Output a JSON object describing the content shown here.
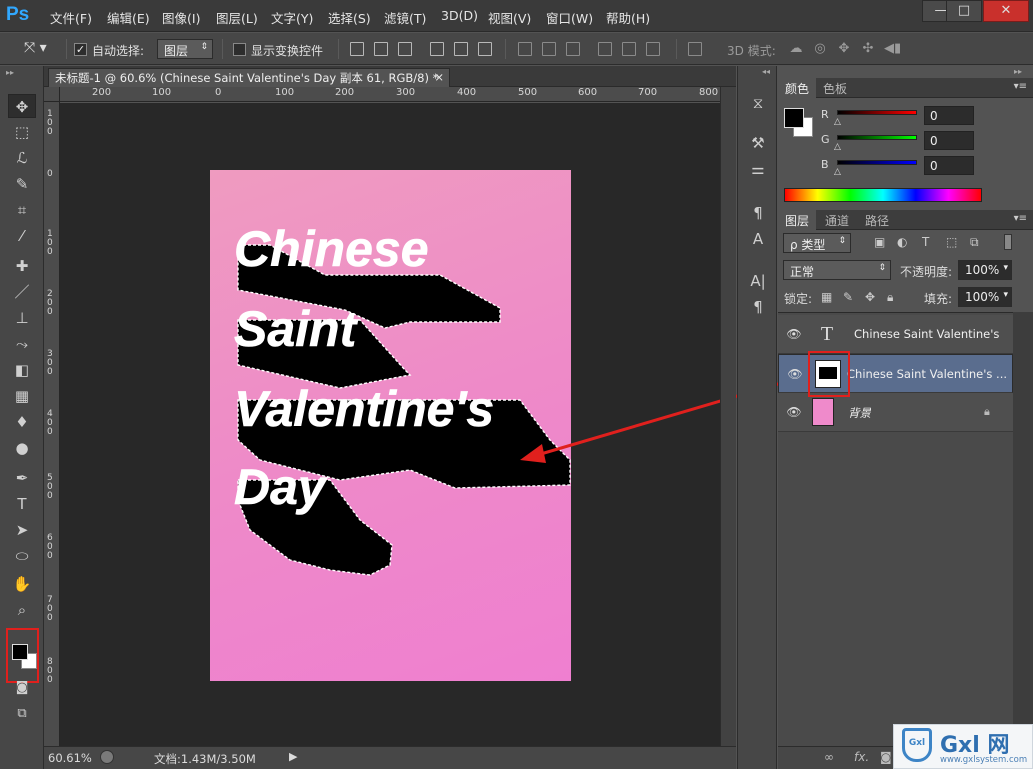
{
  "app": {
    "logo": "Ps"
  },
  "menu": [
    "文件(F)",
    "编辑(E)",
    "图像(I)",
    "图层(L)",
    "文字(Y)",
    "选择(S)",
    "滤镜(T)",
    "3D(D)",
    "视图(V)",
    "窗口(W)",
    "帮助(H)"
  ],
  "window": {
    "min": "—",
    "max": "□",
    "close": "✕"
  },
  "options": {
    "auto_select_label": "自动选择:",
    "auto_select_value": "图层",
    "show_transform_label": "显示变换控件",
    "mode_3d_label": "3D 模式:"
  },
  "document": {
    "tab_title": "未标题-1 @ 60.6% (Chinese  Saint  Valentine's  Day 副本 61, RGB/8) *",
    "tab_close": "×",
    "ruler_top": [
      "200",
      "100",
      "0",
      "100",
      "200",
      "300",
      "400",
      "500",
      "600",
      "700",
      "800"
    ],
    "ruler_left": [
      "1\n0\n0",
      "0",
      "1\n0\n0",
      "2\n0\n0",
      "3\n0\n0",
      "4\n0\n0",
      "5\n0\n0",
      "6\n0\n0",
      "7\n0\n0",
      "8\n0\n0"
    ],
    "canvas_lines": [
      "Chinese",
      "Saint",
      "Valentine's",
      "Day"
    ]
  },
  "status": {
    "zoom": "60.61%",
    "doc_info": "文档:1.43M/3.50M"
  },
  "color_panel": {
    "tabs": [
      "颜色",
      "色板"
    ],
    "channels": [
      {
        "label": "R",
        "value": "0",
        "color": "#d83030"
      },
      {
        "label": "G",
        "value": "0",
        "color": "#30c030"
      },
      {
        "label": "B",
        "value": "0",
        "color": "#3040d8"
      }
    ]
  },
  "layers_panel": {
    "tabs": [
      "图层",
      "通道",
      "路径"
    ],
    "filter_label": "ρ 类型",
    "blend_mode": "正常",
    "opacity_label": "不透明度:",
    "opacity_value": "100%",
    "lock_label": "锁定:",
    "fill_label": "填充:",
    "fill_value": "100%",
    "layers": [
      {
        "name": "Chinese  Saint  Valentine's ...",
        "kind": "text"
      },
      {
        "name": "Chinese  Saint  Valentine's ...",
        "kind": "raster",
        "selected": true
      },
      {
        "name": "背景",
        "kind": "background"
      }
    ]
  },
  "watermark": {
    "text": "Gxl 网",
    "url": "www.gxlsystem.com",
    "badge": "Gxl"
  },
  "colors": {
    "accent": "#31a8ff",
    "annotation": "#e0201d",
    "selected_layer": "#5a6d8e"
  }
}
